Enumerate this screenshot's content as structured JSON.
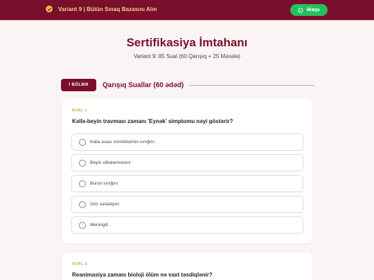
{
  "topbar": {
    "promo_text": "Variant 9 | Bütün Sınaq Bazasını Alın",
    "contact_label": "Əlaqə",
    "colors": {
      "background": "#7a0e2d",
      "promo_text": "#f6d58a",
      "contact_button": "#25c15d"
    },
    "icons": {
      "promo": "check-badge-icon",
      "contact": "whatsapp-icon"
    }
  },
  "header": {
    "title": "Sertifikasiya İmtahanı",
    "subtitle": "Variant 9: 85 Sual (60 Qarışıq + 25 Məsələ)"
  },
  "section": {
    "badge": "I BÖLMƏ",
    "title": "Qarışıq Suallar (60 ədəd)"
  },
  "questions": [
    {
      "number_label": "SUAL 1",
      "text": "Kəllə-beyin travması zamanı 'Eynək' simptomu nəyi göstərir?",
      "options": [
        "Kəllə əsası sümüklərinin sınığını",
        "Beyin silkələnməsini",
        "Burun sınığını",
        "Göz xəstəliyini",
        "Meningiti"
      ]
    },
    {
      "number_label": "SUAL 2",
      "text": "Reanimasiya zamanı bioloji ölüm nə vaxt təsdiqlənir?",
      "options": []
    }
  ]
}
